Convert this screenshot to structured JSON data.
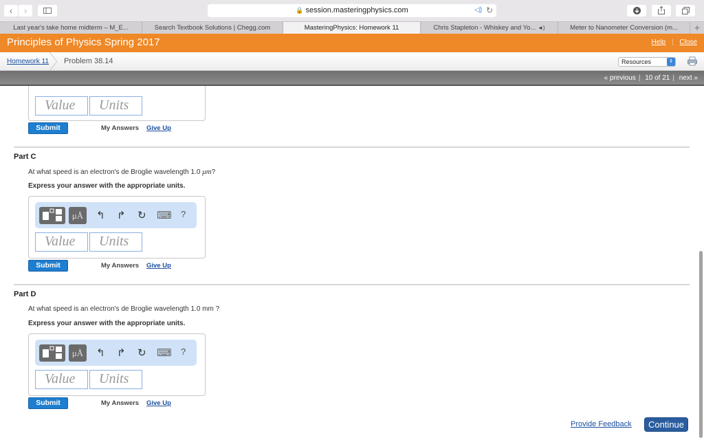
{
  "browser": {
    "url": "session.masteringphysics.com",
    "tabs": [
      {
        "label": "Last year's take home midterm – M_E...",
        "active": false
      },
      {
        "label": "Search Textbook Solutions | Chegg.com",
        "active": false
      },
      {
        "label": "MasteringPhysics: Homework 11",
        "active": true
      },
      {
        "label": "Chris Stapleton - Whiskey and Yo...",
        "active": false,
        "audio": true
      },
      {
        "label": "Meter to Nanometer Conversion (m...",
        "active": false
      }
    ],
    "new_tab_label": "+",
    "icons": {
      "back": "‹",
      "forward": "›",
      "audio": "🔉",
      "reload": "↻",
      "download": "⬇",
      "share": "↑",
      "tabs_overview": "⧉"
    }
  },
  "header": {
    "course_title": "Principles of Physics Spring 2017",
    "help_label": "Help",
    "close_label": "Close",
    "divider": "|"
  },
  "breadcrumb": {
    "homework": "Homework 11",
    "problem": "Problem 38.14"
  },
  "resources_select": {
    "selected": "Resources"
  },
  "pager": {
    "previous": "« previous",
    "position": "10 of 21",
    "next": "next »"
  },
  "answer_common": {
    "value_placeholder": "Value",
    "units_placeholder": "Units",
    "submit_label": "Submit",
    "my_answers_label": "My Answers",
    "give_up_label": "Give Up",
    "toolbar": {
      "units_btn": "μÅ",
      "undo": "↰",
      "redo": "↱",
      "reset": "↻",
      "keyboard": "⌨",
      "help": "?"
    }
  },
  "parts": [
    {
      "title": "Part C",
      "question_prefix": "At what speed is an electron's de Broglie wavelength 1.0 ",
      "question_unit": "μm",
      "question_suffix": "?",
      "instruction": "Express your answer with the appropriate units."
    },
    {
      "title": "Part D",
      "question_prefix": "At what speed is an electron's de Broglie wavelength 1.0 mm ?",
      "question_unit": "",
      "question_suffix": "",
      "instruction": "Express your answer with the appropriate units."
    }
  ],
  "footer": {
    "feedback_label": "Provide Feedback",
    "continue_label": "Continue"
  }
}
